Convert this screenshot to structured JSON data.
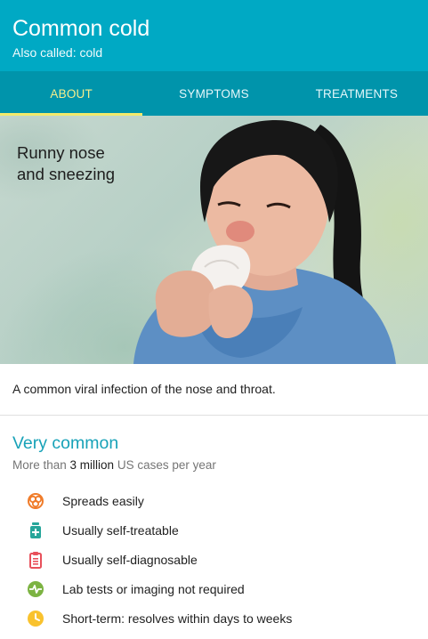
{
  "header": {
    "title": "Common cold",
    "subtitle": "Also called: cold"
  },
  "tabs": [
    {
      "label": "ABOUT",
      "active": true
    },
    {
      "label": "SYMPTOMS",
      "active": false
    },
    {
      "label": "TREATMENTS",
      "active": false
    }
  ],
  "hero": {
    "caption": "Runny nose\nand sneezing"
  },
  "description": "A common viral infection of the nose and throat.",
  "prevalence": {
    "title": "Very common",
    "stat_prefix": "More than ",
    "stat_value": "3 million",
    "stat_suffix": " US cases per year"
  },
  "facts": [
    {
      "icon": "biohazard-icon",
      "color": "#f07c2a",
      "label": "Spreads easily"
    },
    {
      "icon": "medicine-bottle-icon",
      "color": "#26a69a",
      "label": "Usually self-treatable"
    },
    {
      "icon": "clipboard-icon",
      "color": "#e8505b",
      "label": "Usually self-diagnosable"
    },
    {
      "icon": "pulse-icon",
      "color": "#7cb342",
      "label": "Lab tests or imaging not required"
    },
    {
      "icon": "clock-icon",
      "color": "#f9c22e",
      "label": "Short-term: resolves within days to weeks"
    }
  ],
  "colors": {
    "header": "#00a9c4",
    "tabs": "#0094ab",
    "active_tab": "#f6ee8c",
    "accent_title": "#18a2b8"
  }
}
